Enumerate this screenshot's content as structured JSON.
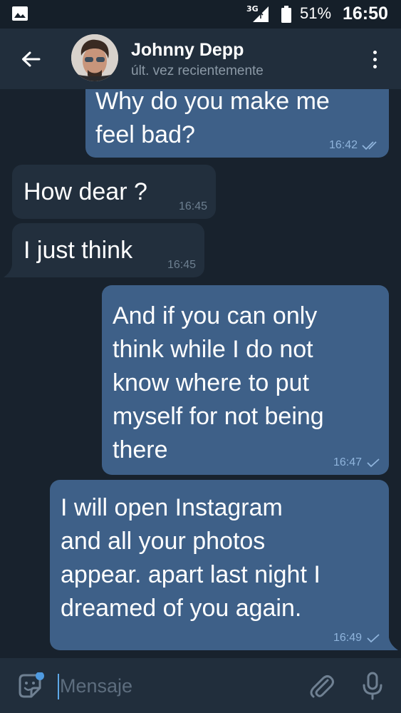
{
  "status_bar": {
    "network": "3G",
    "battery_percent": "51%",
    "time": "16:50",
    "icons": [
      "gallery-icon",
      "signal-icon",
      "battery-icon"
    ]
  },
  "header": {
    "back_icon": "arrow-left-icon",
    "contact_name": "Johnny Depp",
    "contact_status": "últ. vez recientemente",
    "menu_icon": "more-vert-icon"
  },
  "messages": [
    {
      "direction": "out",
      "text": "Why do you make me\nfeel bad?",
      "time": "16:42",
      "status": "read"
    },
    {
      "direction": "in",
      "text": "How dear ?",
      "time": "16:45"
    },
    {
      "direction": "in",
      "text": "I just think",
      "time": "16:45"
    },
    {
      "direction": "out",
      "text": "And if you can only\nthink while I do not\nknow where to put\nmyself for not being\nthere",
      "time": "16:47",
      "status": "sent"
    },
    {
      "direction": "out",
      "text": "I will open Instagram\nand all your photos\nappear. apart last night I\ndreamed of you again.",
      "time": "16:49",
      "status": "sent"
    }
  ],
  "composer": {
    "placeholder": "Mensaje",
    "value": "",
    "emoji_icon": "sticker-emoji-icon",
    "attach_icon": "paperclip-icon",
    "mic_icon": "microphone-icon"
  },
  "colors": {
    "background": "#18222d",
    "header": "#212e3c",
    "outgoing_bubble": "#3e6088",
    "incoming_bubble": "#222f3d",
    "accent": "#5ea9e8"
  }
}
